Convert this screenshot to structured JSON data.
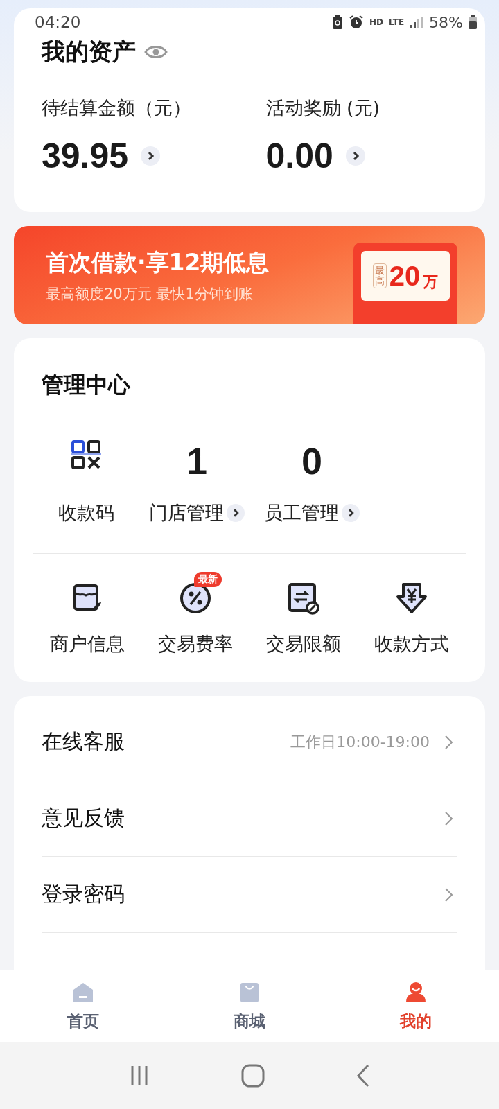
{
  "status_bar": {
    "time": "04:20",
    "network_labels": [
      "HD",
      "LTE"
    ],
    "battery": "58%"
  },
  "assets": {
    "title": "我的资产",
    "fields": [
      {
        "label": "待结算金额（元）",
        "value": "39.95"
      },
      {
        "label": "活动奖励 (元)",
        "value": "0.00"
      }
    ]
  },
  "banner": {
    "title": "首次借款·享12期低息",
    "subtitle": "最高额度20万元 最快1分钟到账",
    "badge_prefix": "最高",
    "badge_amount": "20",
    "badge_unit": "万"
  },
  "management": {
    "title": "管理中心",
    "stats": [
      {
        "kind": "icon",
        "label": "收款码"
      },
      {
        "kind": "count",
        "value": "1",
        "label": "门店管理"
      },
      {
        "kind": "count",
        "value": "0",
        "label": "员工管理"
      }
    ],
    "tools": [
      {
        "kind": "store",
        "label": "商户信息"
      },
      {
        "kind": "percent",
        "label": "交易费率",
        "badge": "最新"
      },
      {
        "kind": "limit",
        "label": "交易限额"
      },
      {
        "kind": "yen",
        "label": "收款方式"
      }
    ]
  },
  "menu": [
    {
      "label": "在线客服",
      "hint": "工作日10:00-19:00"
    },
    {
      "label": "意见反馈"
    },
    {
      "label": "登录密码"
    }
  ],
  "tabs": [
    {
      "kind": "home",
      "label": "首页",
      "selected": false
    },
    {
      "kind": "bag",
      "label": "商城",
      "selected": false
    },
    {
      "kind": "person",
      "label": "我的",
      "selected": true
    }
  ]
}
